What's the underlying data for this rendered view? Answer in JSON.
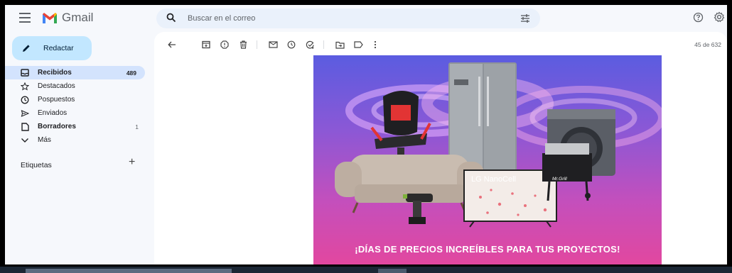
{
  "app": {
    "name": "Gmail",
    "brand_colors": {
      "red": "#ea4335",
      "blue": "#4285f4",
      "green": "#34a853",
      "yellow": "#fbbc04"
    }
  },
  "search": {
    "placeholder": "Buscar en el correo"
  },
  "header_icons": [
    "menu-icon",
    "search-icon",
    "tune-icon",
    "help-icon",
    "settings-icon"
  ],
  "compose": {
    "label": "Redactar"
  },
  "sidebar": {
    "items": [
      {
        "label": "Recibidos",
        "count": "489",
        "icon": "inbox-icon",
        "active": true,
        "bold": true
      },
      {
        "label": "Destacados",
        "count": "",
        "icon": "star-icon",
        "active": false,
        "bold": false
      },
      {
        "label": "Pospuestos",
        "count": "",
        "icon": "clock-icon",
        "active": false,
        "bold": false
      },
      {
        "label": "Enviados",
        "count": "",
        "icon": "send-icon",
        "active": false,
        "bold": false
      },
      {
        "label": "Borradores",
        "count": "1",
        "icon": "draft-icon",
        "active": false,
        "bold": true
      },
      {
        "label": "Más",
        "count": "",
        "icon": "chevron-down-icon",
        "active": false,
        "bold": false
      }
    ],
    "labels_heading": "Etiquetas",
    "labels_add": "+"
  },
  "toolbar": {
    "icons": [
      "back-arrow-icon",
      "archive-icon",
      "report-spam-icon",
      "delete-icon",
      "mark-unread-icon",
      "snooze-icon",
      "add-task-icon",
      "move-to-icon",
      "label-icon",
      "more-vert-icon"
    ],
    "pager": "45 de 632"
  },
  "email": {
    "banner_headline": "¡DÍAS DE PRECIOS INCREÍBLES PARA TUS PROYECTOS!",
    "product_text_tv": "LG NanoCell",
    "product_text_grill": "Mr.Grill",
    "banner_colors": {
      "top": "#5b5ce0",
      "bottom": "#e2479f"
    }
  }
}
